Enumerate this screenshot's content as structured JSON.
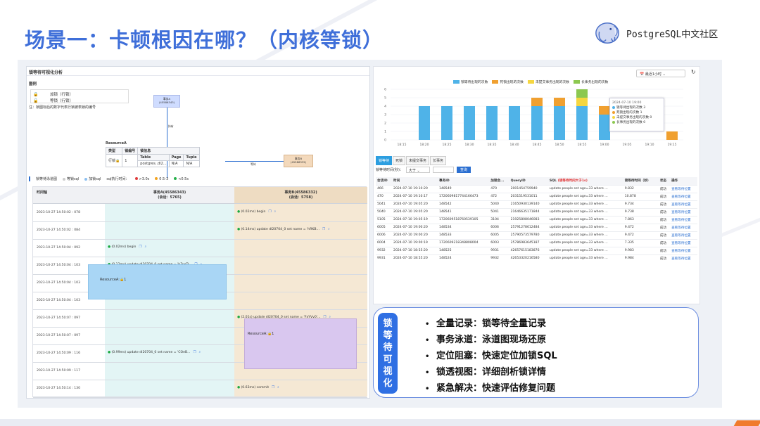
{
  "slide": {
    "title": "场景一：卡顿根因在哪？（内核等锁）",
    "logo_text": "PostgreSQL中文社区"
  },
  "left_panel": {
    "title": "锁等待可视化分析",
    "legend_heading": "图例",
    "legend_items": [
      "加锁（行锁）",
      "等锁（行锁）"
    ],
    "note": "注：锁图标后的数字代表行锁被表锁的编号",
    "node_a": {
      "label": "事务A",
      "id": "(45586343)"
    },
    "node_b": {
      "label": "事务B",
      "id": "(45586332)"
    },
    "edge_hold": "持有",
    "edge_wait": "等待",
    "resource": {
      "label": "ResourceA",
      "headers": [
        "类型",
        "锁编号",
        "锁信息"
      ],
      "sub_headers": [
        "Table",
        "Page",
        "Tuple"
      ],
      "row_type": "行锁",
      "row_num": "1",
      "values": [
        "postgres..dl2...",
        "N/A",
        "N/A"
      ]
    },
    "filter": {
      "label": "锁等待泳道图",
      "opt1": "等锁sql",
      "opt2": "加锁sql",
      "opt3": "sql执行时间：",
      "levels": [
        ">3.0s",
        "0.5-3",
        "<0.5s"
      ],
      "level_colors": [
        "#e03c3c",
        "#f3a41f",
        "#25b14a"
      ]
    },
    "grid": {
      "time_header": "时间轴",
      "a_header": "事务A(45586343)",
      "a_sub": "(会话：5765)",
      "b_header": "事务B(45586332)",
      "b_sub": "(会话：5758)",
      "times": [
        "2023-10-27 14:50:02 : 078",
        "2023-10-27 14:50:02 : 084",
        "2023-10-27 14:50:04 : 092",
        "2023-10-27 14:50:04 : 103",
        "2023-10-27 14:50:04 : 103",
        "2023-10-27 14:50:04 : 103",
        "2023-10-27 14:50:07 : 097",
        "2023-10-27 14:50:07 : 097",
        "2023-10-27 14:50:09 : 116",
        "2023-10-27 14:50:09 : 117",
        "2023-10-27 14:50:14 : 130"
      ],
      "events_a": [
        {
          "row": 2,
          "text": "(0.02ms) begin"
        },
        {
          "row": 3,
          "text": "(0.12ms) update dl20704_0 set name = 'h7psTr..."
        },
        {
          "row": 8,
          "text": "(0.99ms) update dl20704_0 set name = 'COeB..."
        }
      ],
      "events_b": [
        {
          "row": 0,
          "text": "(0.02ms) begin"
        },
        {
          "row": 1,
          "text": "(0.14ms) update dl20704_0 set name = 'hRKB..."
        },
        {
          "row": 6,
          "text": "(2.01s) update dl20704_0 set name = 'FxYVv0'..."
        },
        {
          "row": 10,
          "text": "(0.63ms) commit"
        }
      ],
      "block_a": "ResourceA:🔒1",
      "block_b": "ResourceA:🔒1"
    }
  },
  "right_panel": {
    "range": "最近1小时",
    "legend": [
      {
        "name": "锁等待出现的次数",
        "color": "#4fb3e8"
      },
      {
        "name": "死锁出现的次数",
        "color": "#f0a030"
      },
      {
        "name": "未提交事务出现的次数",
        "color": "#f5d640"
      },
      {
        "name": "长事务出现的次数",
        "color": "#8cc850"
      }
    ],
    "tooltip": {
      "time": "2024-07-10 19:00",
      "rows": [
        "锁等待出现的次数  3",
        "死锁出现的次数  1",
        "未提交事务出现的次数  0",
        "长事务出现的次数  0"
      ]
    },
    "tabs": [
      "锁等待",
      "死锁",
      "未提交事务",
      "长事务"
    ],
    "filter_label": "锁等待时间(秒)：",
    "filter_value": "大于",
    "query_btn": "查询",
    "columns": [
      "会话ID",
      "时间",
      "事务ID",
      "加锁会...",
      "QueryID",
      "SQL",
      "锁等待时间（秒）",
      "状态",
      "操作"
    ],
    "sql_hint": "(锁等待时间大于1s)",
    "rows": [
      [
        "466",
        "2024-07-10 19:10:20",
        "148549",
        "470",
        "2001454759940",
        "update people set age=33 where ...",
        "9.832",
        "成功",
        "查看等待位置"
      ],
      [
        "470",
        "2024-07-10 19:10:17",
        "1720609817744166473",
        "472",
        "2031519531011",
        "update people set age=33 where ...",
        "10.878",
        "成功",
        "查看等待位置"
      ],
      [
        "5041",
        "2024-07-10 19:05:20",
        "148542",
        "5040",
        "21650930139140",
        "update people set age=33 where ...",
        "9.734",
        "成功",
        "查看等待位置"
      ],
      [
        "5040",
        "2024-07-10 19:05:20",
        "148541",
        "5041",
        "21646635171844",
        "update people set age=33 where ...",
        "9.738",
        "成功",
        "查看等待位置"
      ],
      [
        "5105",
        "2024-07-10 19:05:19",
        "1720609518760539105",
        "3104",
        "21925808046083",
        "update people set age=33 where ...",
        "7.863",
        "成功",
        "查看等待位置"
      ],
      [
        "6005",
        "2024-07-10 19:00:20",
        "148534",
        "6006",
        "25791278612484",
        "update people set age=33 where ...",
        "9.472",
        "成功",
        "查看等待位置"
      ],
      [
        "6006",
        "2024-07-10 19:00:20",
        "148533",
        "6005",
        "25790573579780",
        "update people set age=33 where ...",
        "9.472",
        "成功",
        "查看等待位置"
      ],
      [
        "6004",
        "2024-07-10 19:00:19",
        "1720609218348808004",
        "6003",
        "25786983645187",
        "update people set age=33 where ...",
        "7.335",
        "成功",
        "查看等待位置"
      ],
      [
        "9932",
        "2024-07-10 18:55:20",
        "148525",
        "9931",
        "42657615183876",
        "update people set age=33 where ...",
        "9.983",
        "成功",
        "查看等待位置"
      ],
      [
        "9931",
        "2024-07-10 18:55:20",
        "148524",
        "9932",
        "42653320216580",
        "update people set age=33 where ...",
        "9.984",
        "成功",
        "查看等待位置"
      ]
    ]
  },
  "chart_data": {
    "type": "bar",
    "stacked": true,
    "categories": [
      "18:15",
      "18:20",
      "18:25",
      "18:30",
      "18:35",
      "18:40",
      "18:45",
      "18:50",
      "18:55",
      "19:00",
      "19:05",
      "19:10",
      "19:15"
    ],
    "series": [
      {
        "name": "锁等待出现的次数",
        "values": [
          0,
          4,
          4,
          4,
          4,
          4,
          4,
          4,
          4,
          3,
          0,
          0,
          0
        ]
      },
      {
        "name": "死锁出现的次数",
        "values": [
          0,
          0,
          0,
          0,
          0,
          0,
          1,
          1,
          0,
          1,
          0,
          0,
          1
        ]
      },
      {
        "name": "未提交事务出现的次数",
        "values": [
          0,
          0,
          0,
          0,
          0,
          0,
          0,
          0,
          1,
          0,
          0,
          0,
          0
        ]
      },
      {
        "name": "长事务出现的次数",
        "values": [
          0,
          0,
          0,
          0,
          0,
          0,
          0,
          0,
          1,
          0,
          0,
          0,
          0
        ]
      }
    ],
    "ylim": [
      0,
      6
    ],
    "yticks": [
      0,
      1,
      2,
      3,
      4,
      5,
      6
    ],
    "legend_position": "top",
    "grid": true
  },
  "features": {
    "badge": [
      "锁",
      "等",
      "待",
      "可",
      "视",
      "化"
    ],
    "items": [
      "全量记录：锁等待全量记录",
      "事务泳道：泳道图现场还原",
      "定位阻塞：快速定位加锁SQL",
      "锁透视图：详细剖析锁详情",
      "紧急解决：快速评估修复问题"
    ]
  }
}
